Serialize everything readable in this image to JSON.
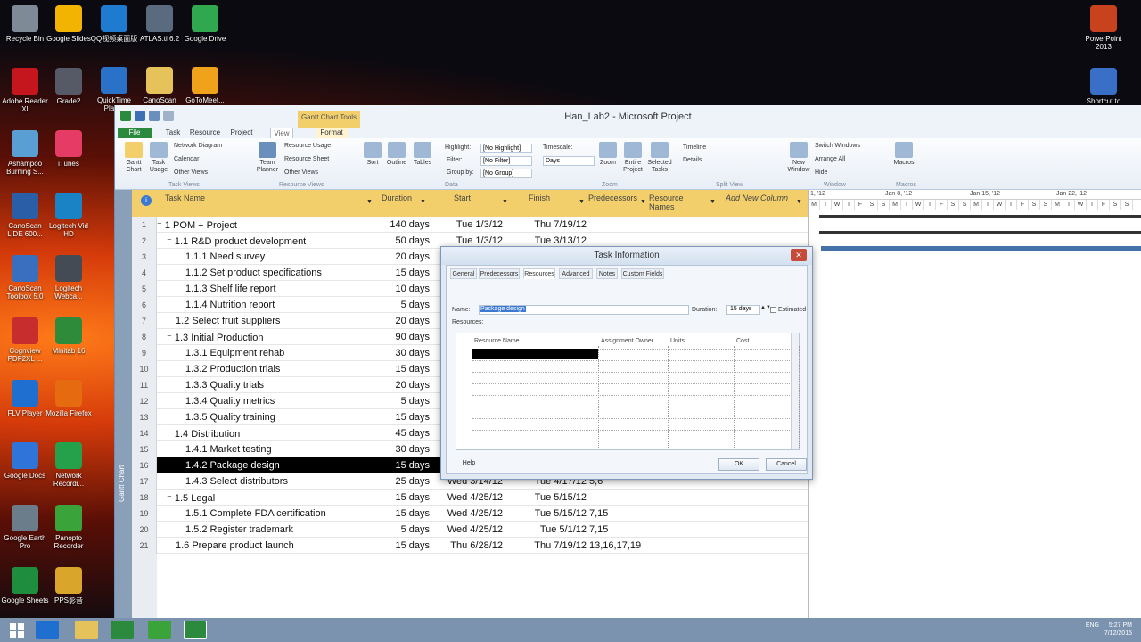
{
  "desktop": {
    "icons_left": [
      {
        "label": "Recycle Bin",
        "color": "#7e8a96"
      },
      {
        "label": "Adobe Reader XI",
        "color": "#c4161c"
      },
      {
        "label": "Ashampoo Burning S...",
        "color": "#5a9fd4"
      },
      {
        "label": "CanoScan LiDE 600...",
        "color": "#2a5fa8"
      },
      {
        "label": "CanoScan Toolbox 5.0",
        "color": "#3a6fc0"
      },
      {
        "label": "Cognview PDF2XL ...",
        "color": "#c82d2d"
      },
      {
        "label": "FLV Player",
        "color": "#1f6fd1"
      },
      {
        "label": "Google Docs",
        "color": "#2f74d8"
      },
      {
        "label": "Google Earth Pro",
        "color": "#6b7c8a"
      },
      {
        "label": "Google Sheets",
        "color": "#1e8e3e"
      }
    ],
    "icons_col2": [
      {
        "label": "Google Slides",
        "color": "#f2b400"
      },
      {
        "label": "Grade2",
        "color": "#555a66"
      },
      {
        "label": "iTunes",
        "color": "#e53b64"
      },
      {
        "label": "Logitech Vid HD",
        "color": "#1a83c6"
      },
      {
        "label": "Logitech Webca...",
        "color": "#444b55"
      },
      {
        "label": "Minitab 16",
        "color": "#2e8b3a"
      },
      {
        "label": "Mozilla Firefox",
        "color": "#e66a10"
      },
      {
        "label": "Network Recordi...",
        "color": "#26a14b"
      },
      {
        "label": "Panopto Recorder",
        "color": "#3aa33a"
      },
      {
        "label": "PPS影音",
        "color": "#d9a52a"
      }
    ],
    "icons_top": [
      {
        "label": "QQ视频桌面版",
        "color": "#1f7bd0"
      },
      {
        "label": "ATLAS.ti 6.2",
        "color": "#5a6b80"
      },
      {
        "label": "Google Drive",
        "color": "#2fa84f"
      }
    ],
    "icons_top2": [
      {
        "label": "QuickTime Player",
        "color": "#2a72c8"
      },
      {
        "label": "CanoScan",
        "color": "#e5c25a"
      },
      {
        "label": "GoToMeet...",
        "color": "#f0a21b"
      }
    ],
    "icons_right": [
      {
        "label": "PowerPoint 2013",
        "color": "#c9421e"
      },
      {
        "label": "Shortcut to",
        "color": "#3a6fc8"
      }
    ]
  },
  "app": {
    "title": "Han_Lab2 - Microsoft Project",
    "contextual_group": "Gantt Chart Tools",
    "tabs": [
      "File",
      "Task",
      "Resource",
      "Project",
      "View",
      "Format"
    ],
    "ribbon": {
      "big_buttons": [
        {
          "label": "Gantt Chart",
          "name": "gantt-chart-button"
        },
        {
          "label": "Task Usage",
          "name": "task-usage-button"
        },
        {
          "label": "Team Planner",
          "name": "team-planner-button"
        },
        {
          "label": "Sort",
          "name": "sort-button"
        },
        {
          "label": "Outline",
          "name": "outline-button"
        },
        {
          "label": "Tables",
          "name": "tables-button"
        },
        {
          "label": "Zoom",
          "name": "zoom-button"
        },
        {
          "label": "Entire Project",
          "name": "entire-project-button"
        },
        {
          "label": "Selected Tasks",
          "name": "selected-tasks-button"
        },
        {
          "label": "New Window",
          "name": "new-window-button"
        },
        {
          "label": "Macros",
          "name": "macros-button"
        }
      ],
      "small_buttons": [
        "Network Diagram",
        "Calendar",
        "Other Views",
        "Resource Usage",
        "Resource Sheet",
        "Other Views",
        "Timeline",
        "Details",
        "Switch Windows",
        "Arrange All",
        "Hide"
      ],
      "highlight_label": "Highlight:",
      "highlight_value": "[No Highlight]",
      "filter_label": "Filter:",
      "filter_value": "[No Filter]",
      "group_label": "Group by:",
      "group_value": "[No Group]",
      "timescale_label": "Timescale:",
      "timescale_value": "Days",
      "groups": [
        "Task Views",
        "Resource Views",
        "Data",
        "Zoom",
        "Split View",
        "Window",
        "Macros"
      ]
    },
    "view_bar_label": "Gantt Chart",
    "columns": {
      "task_name": "Task Name",
      "duration": "Duration",
      "start": "Start",
      "finish": "Finish",
      "predecessors": "Predecessors",
      "resource_names": "Resource Names",
      "add_new": "Add New Column"
    },
    "tasks": [
      {
        "id": "1",
        "name": "1 POM + Project",
        "duration": "140 days",
        "start": "Tue 1/3/12",
        "finish": "Thu 7/19/12",
        "pred": "",
        "indent": 0,
        "collapse": true
      },
      {
        "id": "2",
        "name": "1.1 R&D product development",
        "duration": "50 days",
        "start": "Tue 1/3/12",
        "finish": "Tue 3/13/12",
        "pred": "",
        "indent": 1,
        "collapse": true
      },
      {
        "id": "3",
        "name": "1.1.1 Need survey",
        "duration": "20 days",
        "start": "",
        "finish": "",
        "pred": "",
        "indent": 2,
        "collapse": false
      },
      {
        "id": "4",
        "name": "1.1.2 Set product specifications",
        "duration": "15 days",
        "start": "",
        "finish": "",
        "pred": "",
        "indent": 2,
        "collapse": false
      },
      {
        "id": "5",
        "name": "1.1.3 Shelf life report",
        "duration": "10 days",
        "start": "",
        "finish": "",
        "pred": "",
        "indent": 2,
        "collapse": false
      },
      {
        "id": "6",
        "name": "1.1.4 Nutrition report",
        "duration": "5 days",
        "start": "",
        "finish": "",
        "pred": "",
        "indent": 2,
        "collapse": false
      },
      {
        "id": "7",
        "name": "1.2 Select fruit suppliers",
        "duration": "20 days",
        "start": "",
        "finish": "",
        "pred": "",
        "indent": 1,
        "collapse": false
      },
      {
        "id": "8",
        "name": "1.3 Initial Production",
        "duration": "90 days",
        "start": "",
        "finish": "",
        "pred": "",
        "indent": 1,
        "collapse": true
      },
      {
        "id": "9",
        "name": "1.3.1 Equipment rehab",
        "duration": "30 days",
        "start": "",
        "finish": "",
        "pred": "",
        "indent": 2,
        "collapse": false
      },
      {
        "id": "10",
        "name": "1.3.2 Production trials",
        "duration": "15 days",
        "start": "",
        "finish": "",
        "pred": "",
        "indent": 2,
        "collapse": false
      },
      {
        "id": "11",
        "name": "1.3.3 Quality trials",
        "duration": "20 days",
        "start": "",
        "finish": "",
        "pred": "",
        "indent": 2,
        "collapse": false
      },
      {
        "id": "12",
        "name": "1.3.4 Quality metrics",
        "duration": "5 days",
        "start": "",
        "finish": "",
        "pred": "",
        "indent": 2,
        "collapse": false
      },
      {
        "id": "13",
        "name": "1.3.5 Quality training",
        "duration": "15 days",
        "start": "",
        "finish": "",
        "pred": "",
        "indent": 2,
        "collapse": false
      },
      {
        "id": "14",
        "name": "1.4 Distribution",
        "duration": "45 days",
        "start": "",
        "finish": "",
        "pred": "",
        "indent": 1,
        "collapse": true
      },
      {
        "id": "15",
        "name": "1.4.1 Market testing",
        "duration": "30 days",
        "start": "",
        "finish": "",
        "pred": "",
        "indent": 2,
        "collapse": false
      },
      {
        "id": "16",
        "name": "1.4.2 Package design",
        "duration": "15 days",
        "start": "",
        "finish": "",
        "pred": "",
        "indent": 2,
        "collapse": false
      },
      {
        "id": "17",
        "name": "1.4.3 Select distributors",
        "duration": "25 days",
        "start": "Wed 3/14/12",
        "finish": "Tue 4/17/12",
        "pred": "5,6",
        "indent": 2,
        "collapse": false
      },
      {
        "id": "18",
        "name": "1.5 Legal",
        "duration": "15 days",
        "start": "Wed 4/25/12",
        "finish": "Tue 5/15/12",
        "pred": "",
        "indent": 1,
        "collapse": true
      },
      {
        "id": "19",
        "name": "1.5.1 Complete FDA certification",
        "duration": "15 days",
        "start": "Wed 4/25/12",
        "finish": "Tue 5/15/12",
        "pred": "7,15",
        "indent": 2,
        "collapse": false
      },
      {
        "id": "20",
        "name": "1.5.2 Register trademark",
        "duration": "5 days",
        "start": "Wed 4/25/12",
        "finish": "Tue 5/1/12",
        "pred": "7,15",
        "indent": 2,
        "collapse": false
      },
      {
        "id": "21",
        "name": "1.6 Prepare product launch",
        "duration": "15 days",
        "start": "Thu 6/28/12",
        "finish": "Thu 7/19/12",
        "pred": "13,16,17,19",
        "indent": 1,
        "collapse": false
      }
    ],
    "selected_row": "16",
    "gantt": {
      "weeks": [
        "1, '12",
        "Jan 8, '12",
        "Jan 15, '12",
        "Jan 22, '12"
      ],
      "days": [
        "M",
        "T",
        "W",
        "T",
        "F",
        "S",
        "S",
        "M",
        "T",
        "W",
        "T",
        "F",
        "S",
        "S",
        "M",
        "T",
        "W",
        "T",
        "F",
        "S",
        "S",
        "M",
        "T",
        "W",
        "T",
        "F",
        "S",
        "S"
      ]
    }
  },
  "dialog": {
    "title": "Task Information",
    "tabs": [
      "General",
      "Predecessors",
      "Resources",
      "Advanced",
      "Notes",
      "Custom Fields"
    ],
    "active_tab": "Resources",
    "name_label": "Name:",
    "name_value": "Package design",
    "duration_label": "Duration:",
    "duration_value": "15 days",
    "estimated_label": "Estimated",
    "resources_label": "Resources:",
    "table_headers": [
      "Resource Name",
      "Assignment Owner",
      "Units",
      "Cost"
    ],
    "help": "Help",
    "ok": "OK",
    "cancel": "Cancel"
  },
  "taskbar": {
    "clock_time": "5:27 PM",
    "clock_date": "7/12/2015",
    "lang": "ENG"
  }
}
